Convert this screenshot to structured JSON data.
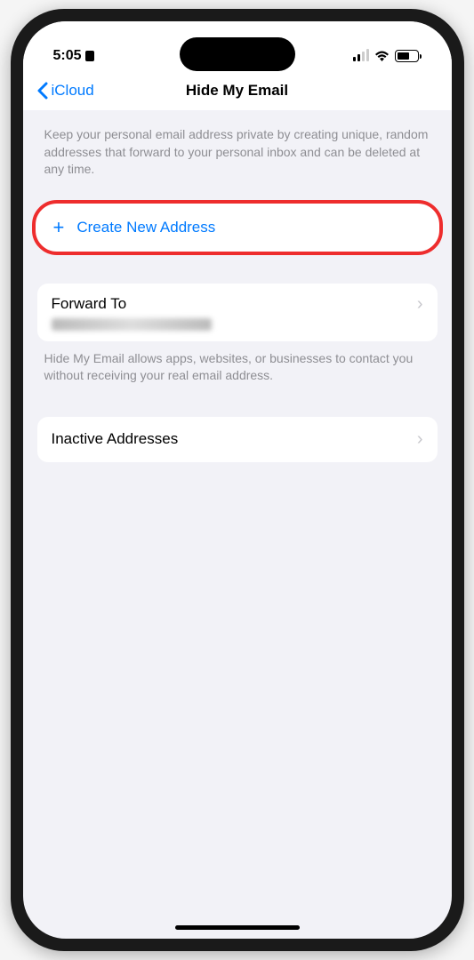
{
  "status": {
    "time": "5:05",
    "battery": "62"
  },
  "nav": {
    "back": "iCloud",
    "title": "Hide My Email"
  },
  "intro": "Keep your personal email address private by creating unique, random addresses that forward to your personal inbox and can be deleted at any time.",
  "create": {
    "label": "Create New Address"
  },
  "forward": {
    "label": "Forward To",
    "footer": "Hide My Email allows apps, websites, or businesses to contact you without receiving your real email address."
  },
  "inactive": {
    "label": "Inactive Addresses"
  }
}
